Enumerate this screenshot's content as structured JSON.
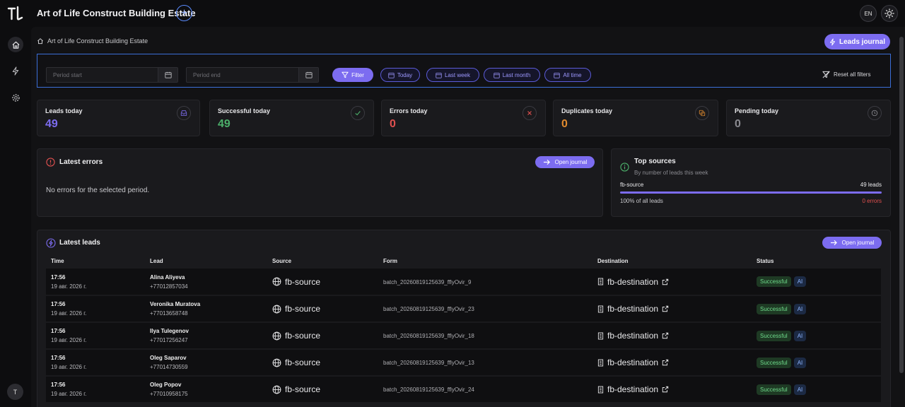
{
  "app": {
    "title": "Art of Life Construct Building Estate",
    "language": "EN"
  },
  "breadcrumb": {
    "label": "Art of Life Construct Building Estate"
  },
  "header": {
    "leads_journal_label": "Leads journal"
  },
  "filters": {
    "period_start_placeholder": "Period start",
    "period_end_placeholder": "Period end",
    "filter_label": "Filter",
    "chips": [
      "Today",
      "Last week",
      "Last month",
      "All time"
    ],
    "reset_label": "Reset all filters"
  },
  "stats": [
    {
      "label": "Leads today",
      "value": "49",
      "color": "#7c6cf0"
    },
    {
      "label": "Successful today",
      "value": "49",
      "color": "#4caf6a"
    },
    {
      "label": "Errors today",
      "value": "0",
      "color": "#e0504f"
    },
    {
      "label": "Duplicates today",
      "value": "0",
      "color": "#e08a2e"
    },
    {
      "label": "Pending today",
      "value": "0",
      "color": "#8a8a90"
    }
  ],
  "latest_errors": {
    "title": "Latest errors",
    "open_label": "Open journal",
    "empty_text": "No errors for the selected period."
  },
  "top_sources": {
    "title": "Top sources",
    "subtitle": "By number of leads this week",
    "source_name": "fb-source",
    "source_count": "49 leads",
    "share_text": "100% of all leads",
    "errors_text": "0 errors",
    "share_fraction": 1.0
  },
  "latest_leads": {
    "title": "Latest leads",
    "open_label": "Open journal",
    "columns": [
      "Time",
      "Lead",
      "Source",
      "Form",
      "Destination",
      "Status"
    ],
    "rows": [
      {
        "time": "17:56",
        "date": "19 авг. 2026 г.",
        "name": "Alina Aliyeva",
        "phone": "+77012857034",
        "source": "fb-source",
        "form": "batch_20260819125639_fflyOvir_9",
        "destination": "fb-destination",
        "status": "Successful",
        "tag": "AI"
      },
      {
        "time": "17:56",
        "date": "19 авг. 2026 г.",
        "name": "Veronika Muratova",
        "phone": "+77013658748",
        "source": "fb-source",
        "form": "batch_20260819125639_fflyOvir_23",
        "destination": "fb-destination",
        "status": "Successful",
        "tag": "AI"
      },
      {
        "time": "17:56",
        "date": "19 авг. 2026 г.",
        "name": "Ilya Tulegenov",
        "phone": "+77017256247",
        "source": "fb-source",
        "form": "batch_20260819125639_fflyOvir_18",
        "destination": "fb-destination",
        "status": "Successful",
        "tag": "AI"
      },
      {
        "time": "17:56",
        "date": "19 авг. 2026 г.",
        "name": "Oleg Saparov",
        "phone": "+77014730559",
        "source": "fb-source",
        "form": "batch_20260819125639_fflyOvir_13",
        "destination": "fb-destination",
        "status": "Successful",
        "tag": "AI"
      },
      {
        "time": "17:56",
        "date": "19 авг. 2026 г.",
        "name": "Oleg Popov",
        "phone": "+77010958175",
        "source": "fb-source",
        "form": "batch_20260819125639_fflyOvir_24",
        "destination": "fb-destination",
        "status": "Successful",
        "tag": "AI"
      }
    ]
  }
}
